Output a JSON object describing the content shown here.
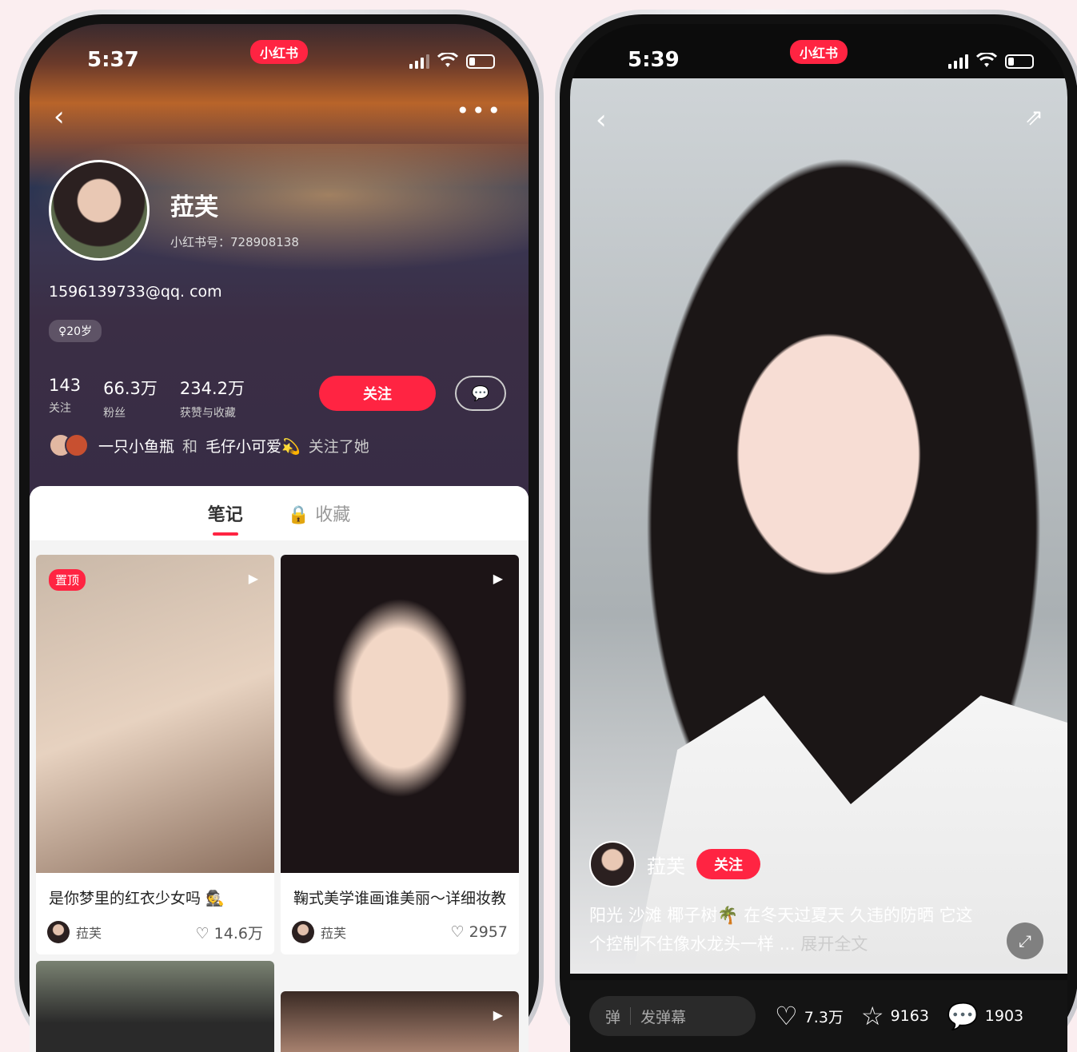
{
  "left": {
    "time": "5:37",
    "app_badge": "小红书",
    "username": "菈芙",
    "user_id": "小红书号：728908138",
    "email": "1596139733@qq. com",
    "age": "♀20岁",
    "stats": [
      {
        "value": "143",
        "label": "关注"
      },
      {
        "value": "66.3万",
        "label": "粉丝"
      },
      {
        "value": "234.2万",
        "label": "获赞与收藏"
      }
    ],
    "follow_label": "关注",
    "mutual_names": "一只小鱼瓶",
    "mutual_and": "和",
    "mutual_names2": "毛仔小可爱💫",
    "mutual_suffix": "关注了她",
    "tabs": [
      {
        "label": "笔记"
      },
      {
        "label": "🔒 收藏"
      }
    ],
    "cards": [
      {
        "pin": "置顶",
        "title": "是你梦里的红衣少女吗 🕵️",
        "author": "菈芙",
        "likes": "♡ 14.6万"
      },
      {
        "title": "鞠式美学谁画谁美丽～详细妆教",
        "author": "菈芙",
        "likes": "♡ 2957"
      }
    ]
  },
  "right": {
    "time": "5:39",
    "app_badge": "小红书",
    "username": "菈芙",
    "follow_label": "关注",
    "caption": "阳光 沙滩 椰子树🌴 在冬天过夏天 久违的防晒 它这个控制不住像水龙头一样 ...",
    "expand": "展开全文",
    "danmu_icon": "弹",
    "danmu_placeholder": "发弹幕",
    "likes": "7.3万",
    "collects": "9163",
    "comments": "1903"
  }
}
